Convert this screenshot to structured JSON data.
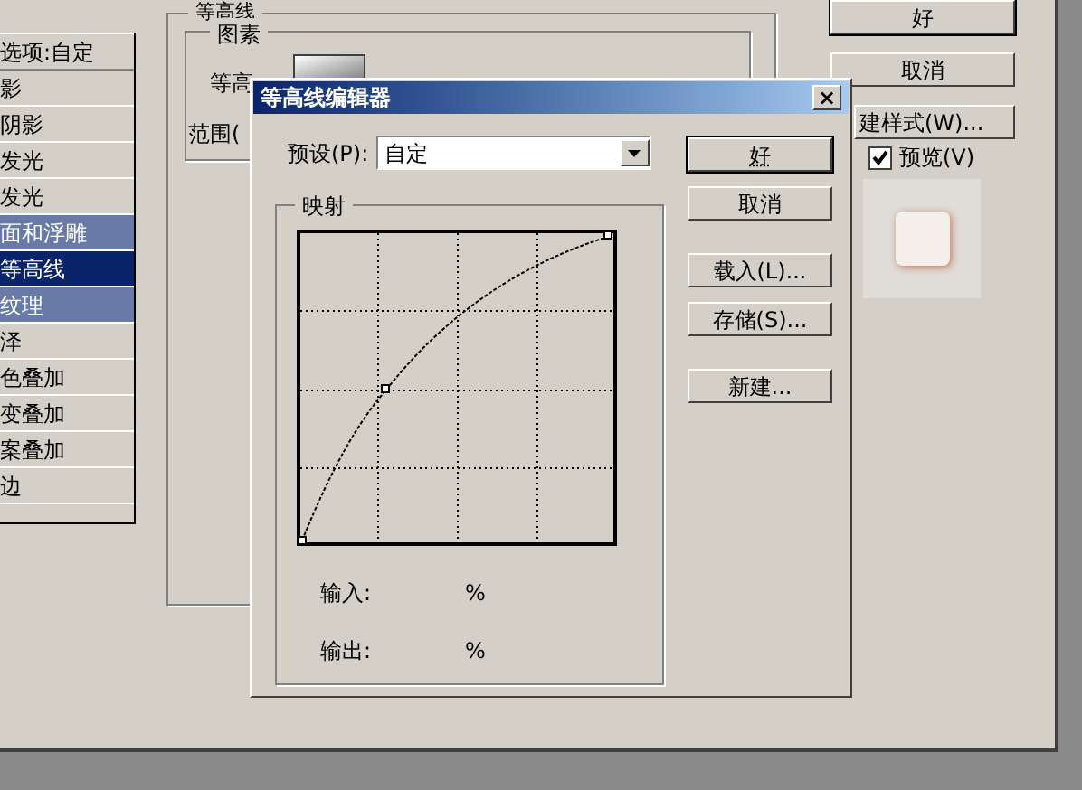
{
  "style_list": {
    "header": "选项:自定",
    "items": [
      {
        "label": "影",
        "selected": false,
        "highlighted": false
      },
      {
        "label": "阴影",
        "selected": false,
        "highlighted": false
      },
      {
        "label": "发光",
        "selected": false,
        "highlighted": false
      },
      {
        "label": "发光",
        "selected": false,
        "highlighted": false
      },
      {
        "label": "面和浮雕",
        "selected": false,
        "highlighted": true
      },
      {
        "label": "等高线",
        "selected": true,
        "highlighted": false
      },
      {
        "label": "纹理",
        "selected": false,
        "highlighted": true
      },
      {
        "label": "泽",
        "selected": false,
        "highlighted": false
      },
      {
        "label": "色叠加",
        "selected": false,
        "highlighted": false
      },
      {
        "label": "变叠加",
        "selected": false,
        "highlighted": false
      },
      {
        "label": "案叠加",
        "selected": false,
        "highlighted": false
      },
      {
        "label": "边",
        "selected": false,
        "highlighted": false
      }
    ]
  },
  "contour_panel": {
    "title": "等高线",
    "group": "图素",
    "contour_label": "等高",
    "range_label": "范围("
  },
  "right_buttons": [
    "好",
    "取消",
    "建样式(W)..."
  ],
  "preview": {
    "label": "预览(V)",
    "checked": true
  },
  "editor": {
    "title": "等高线编辑器",
    "close": "×",
    "preset_label": "预设(P):",
    "preset_value": "自定",
    "buttons": [
      {
        "label": "好",
        "focused": true
      },
      {
        "label": "取消",
        "focused": false
      },
      {
        "label": "载入(L)...",
        "focused": false
      },
      {
        "label": "存储(S)...",
        "focused": false
      },
      {
        "label": "新建...",
        "focused": false
      }
    ],
    "mapping": {
      "title": "映射",
      "input_label": "输入:",
      "input_unit": "%",
      "output_label": "输出:",
      "output_unit": "%"
    }
  }
}
